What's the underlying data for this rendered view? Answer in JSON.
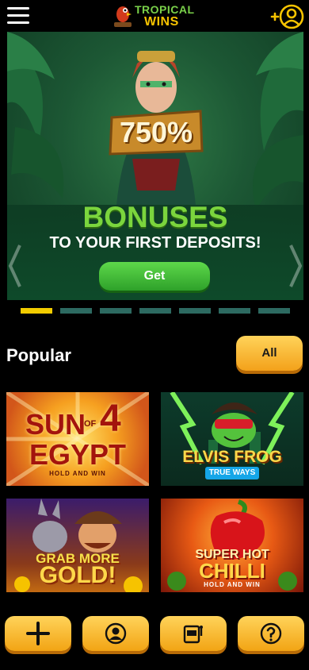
{
  "header": {
    "logo_top": "TROPICAL",
    "logo_bottom": "WINS",
    "menu_icon": "hamburger-icon",
    "user_icon": "add-user-icon"
  },
  "banner": {
    "badge": "750%",
    "title": "BONUSES",
    "subtitle": "TO YOUR FIRST DEPOSITS!",
    "button": "Get",
    "slides_total": 7,
    "active_slide": 1
  },
  "popular": {
    "title": "Popular",
    "all_label": "All",
    "games": [
      {
        "title_a": "SUN",
        "title_num": "4",
        "title_of": "OF",
        "title_b": "EGYPT",
        "tag": "HOLD AND WIN"
      },
      {
        "title_a": "ELVIS FROG",
        "tag": "TRUE WAYS"
      },
      {
        "title_a": "GRAB MORE",
        "title_b": "GOLD!"
      },
      {
        "title_a": "SUPER HOT",
        "title_b": "CHILLI",
        "tag": "HOLD AND WIN"
      }
    ]
  },
  "nav": {
    "items": [
      "plus-icon",
      "account-icon",
      "slot-machine-icon",
      "help-icon"
    ]
  },
  "colors": {
    "accent": "#f6c300",
    "green": "#7bd53d",
    "pager_active": "#f2cc00",
    "pager_inactive": "#2d6a61"
  }
}
